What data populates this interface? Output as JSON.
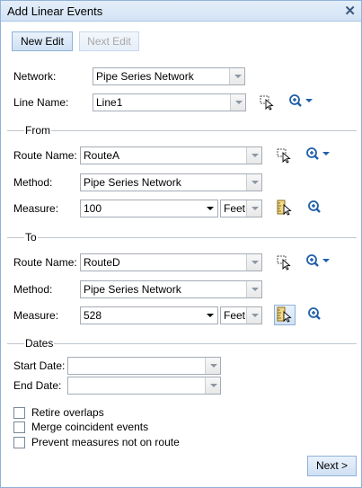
{
  "window": {
    "title": "Add Linear Events",
    "close_glyph": "✕"
  },
  "toolbar": {
    "new_edit": "New Edit",
    "next_edit": "Next Edit"
  },
  "network": {
    "label": "Network:",
    "value": "Pipe Series Network"
  },
  "line_name": {
    "label": "Line Name:",
    "value": "Line1"
  },
  "from": {
    "title": "From",
    "route_label": "Route Name:",
    "route_value": "RouteA",
    "method_label": "Method:",
    "method_value": "Pipe Series Network",
    "measure_label": "Measure:",
    "measure_value": "100",
    "units_value": "Feet"
  },
  "to": {
    "title": "To",
    "route_label": "Route Name:",
    "route_value": "RouteD",
    "method_label": "Method:",
    "method_value": "Pipe Series Network",
    "measure_label": "Measure:",
    "measure_value": "528",
    "units_value": "Feet"
  },
  "dates": {
    "title": "Dates",
    "start_label": "Start Date:",
    "start_value": "",
    "end_label": "End Date:",
    "end_value": ""
  },
  "options": [
    {
      "label": "Retire overlaps",
      "checked": false
    },
    {
      "label": "Merge coincident events",
      "checked": false
    },
    {
      "label": "Prevent measures not on route",
      "checked": false
    }
  ],
  "footer": {
    "next": "Next >"
  },
  "colors": {
    "accent": "#8fb1d9",
    "icon_blue": "#1f5fa8",
    "title_bg": "#d3e3f5"
  },
  "icons": [
    "close-icon",
    "select-from-map-icon",
    "zoom-to-icon",
    "measure-from-map-icon"
  ]
}
